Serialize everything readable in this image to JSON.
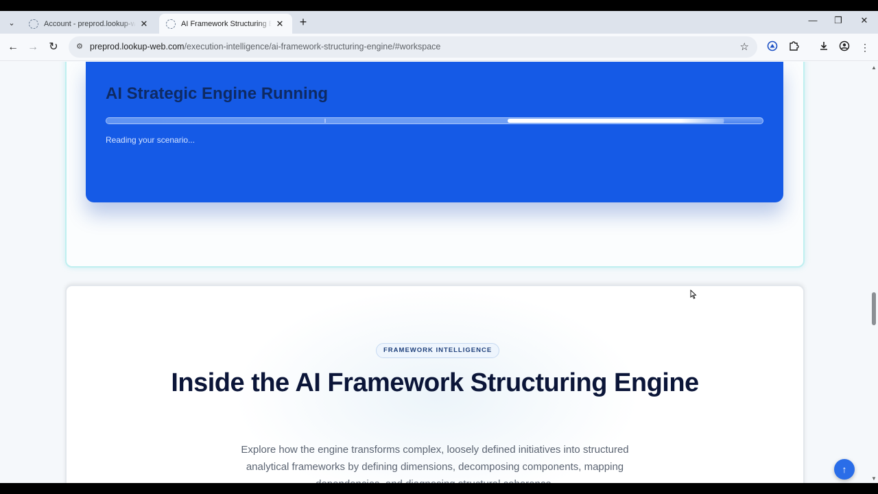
{
  "browser": {
    "tabs": [
      {
        "title": "Account - preprod.lookup-web.com",
        "active": false
      },
      {
        "title": "AI Framework Structuring Engine",
        "active": true
      }
    ],
    "tab_close_glyph": "✕",
    "new_tab_glyph": "+",
    "url_host": "preprod.lookup-web.com",
    "url_path": "/execution-intelligence/ai-framework-structuring-engine/#workspace"
  },
  "engine": {
    "title": "AI Strategic Engine Running",
    "status": "Reading your scenario...",
    "progress": 0.94,
    "accent": "#155ae6"
  },
  "framework": {
    "badge": "FRAMEWORK INTELLIGENCE",
    "title": "Inside the AI Framework Structuring Engine",
    "description": "Explore how the engine transforms complex, loosely defined initiatives into structured analytical frameworks by defining dimensions, decomposing components, mapping dependencies, and diagnosing structural coherence."
  },
  "icons": {
    "back": "back-arrow-icon",
    "forward": "forward-arrow-icon",
    "reload": "reload-icon",
    "scroll_top": "arrow-up-icon"
  }
}
